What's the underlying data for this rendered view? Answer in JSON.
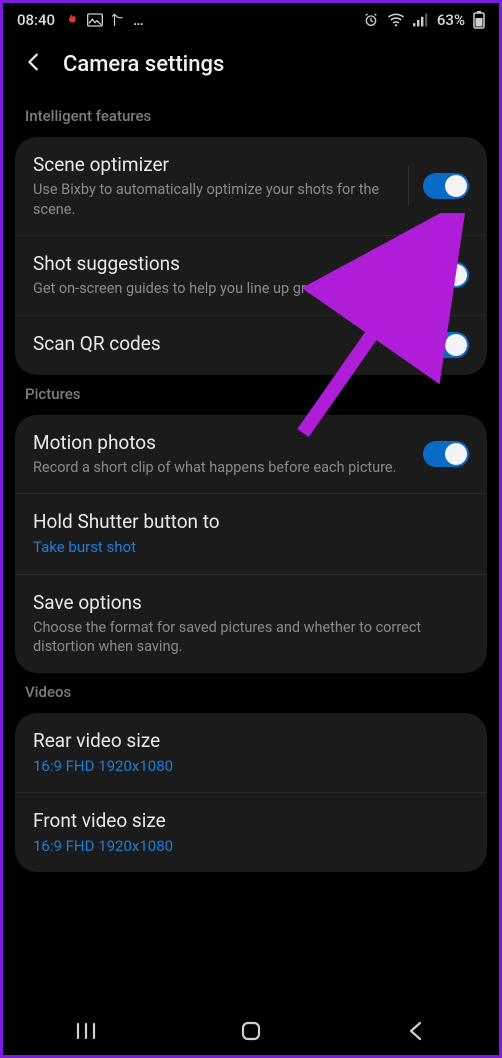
{
  "status": {
    "time": "08:40",
    "battery": "63%",
    "icons": [
      "fire-icon",
      "picture-icon",
      "network-icon",
      "more-icon",
      "alarm-icon",
      "wifi-icon",
      "signal-icon"
    ]
  },
  "header": {
    "title": "Camera settings"
  },
  "sections": {
    "intelligent": {
      "label": "Intelligent features",
      "scene": {
        "title": "Scene optimizer",
        "sub": "Use Bixby to automatically optimize your shots for the scene."
      },
      "shot": {
        "title": "Shot suggestions",
        "sub": "Get on-screen guides to help you line up great shots."
      },
      "qr": {
        "title": "Scan QR codes"
      }
    },
    "pictures": {
      "label": "Pictures",
      "motion": {
        "title": "Motion photos",
        "sub": "Record a short clip of what happens before each picture."
      },
      "shutter": {
        "title": "Hold Shutter button to",
        "sub": "Take burst shot"
      },
      "save": {
        "title": "Save options",
        "sub": "Choose the format for saved pictures and whether to correct distortion when saving."
      }
    },
    "videos": {
      "label": "Videos",
      "rear": {
        "title": "Rear video size",
        "sub": "16:9 FHD 1920x1080"
      },
      "front": {
        "title": "Front video size",
        "sub": "16:9 FHD 1920x1080"
      }
    }
  },
  "colors": {
    "accent": "#0a6bc7",
    "link": "#1d7fd6",
    "annotation": "#b01dd8"
  }
}
